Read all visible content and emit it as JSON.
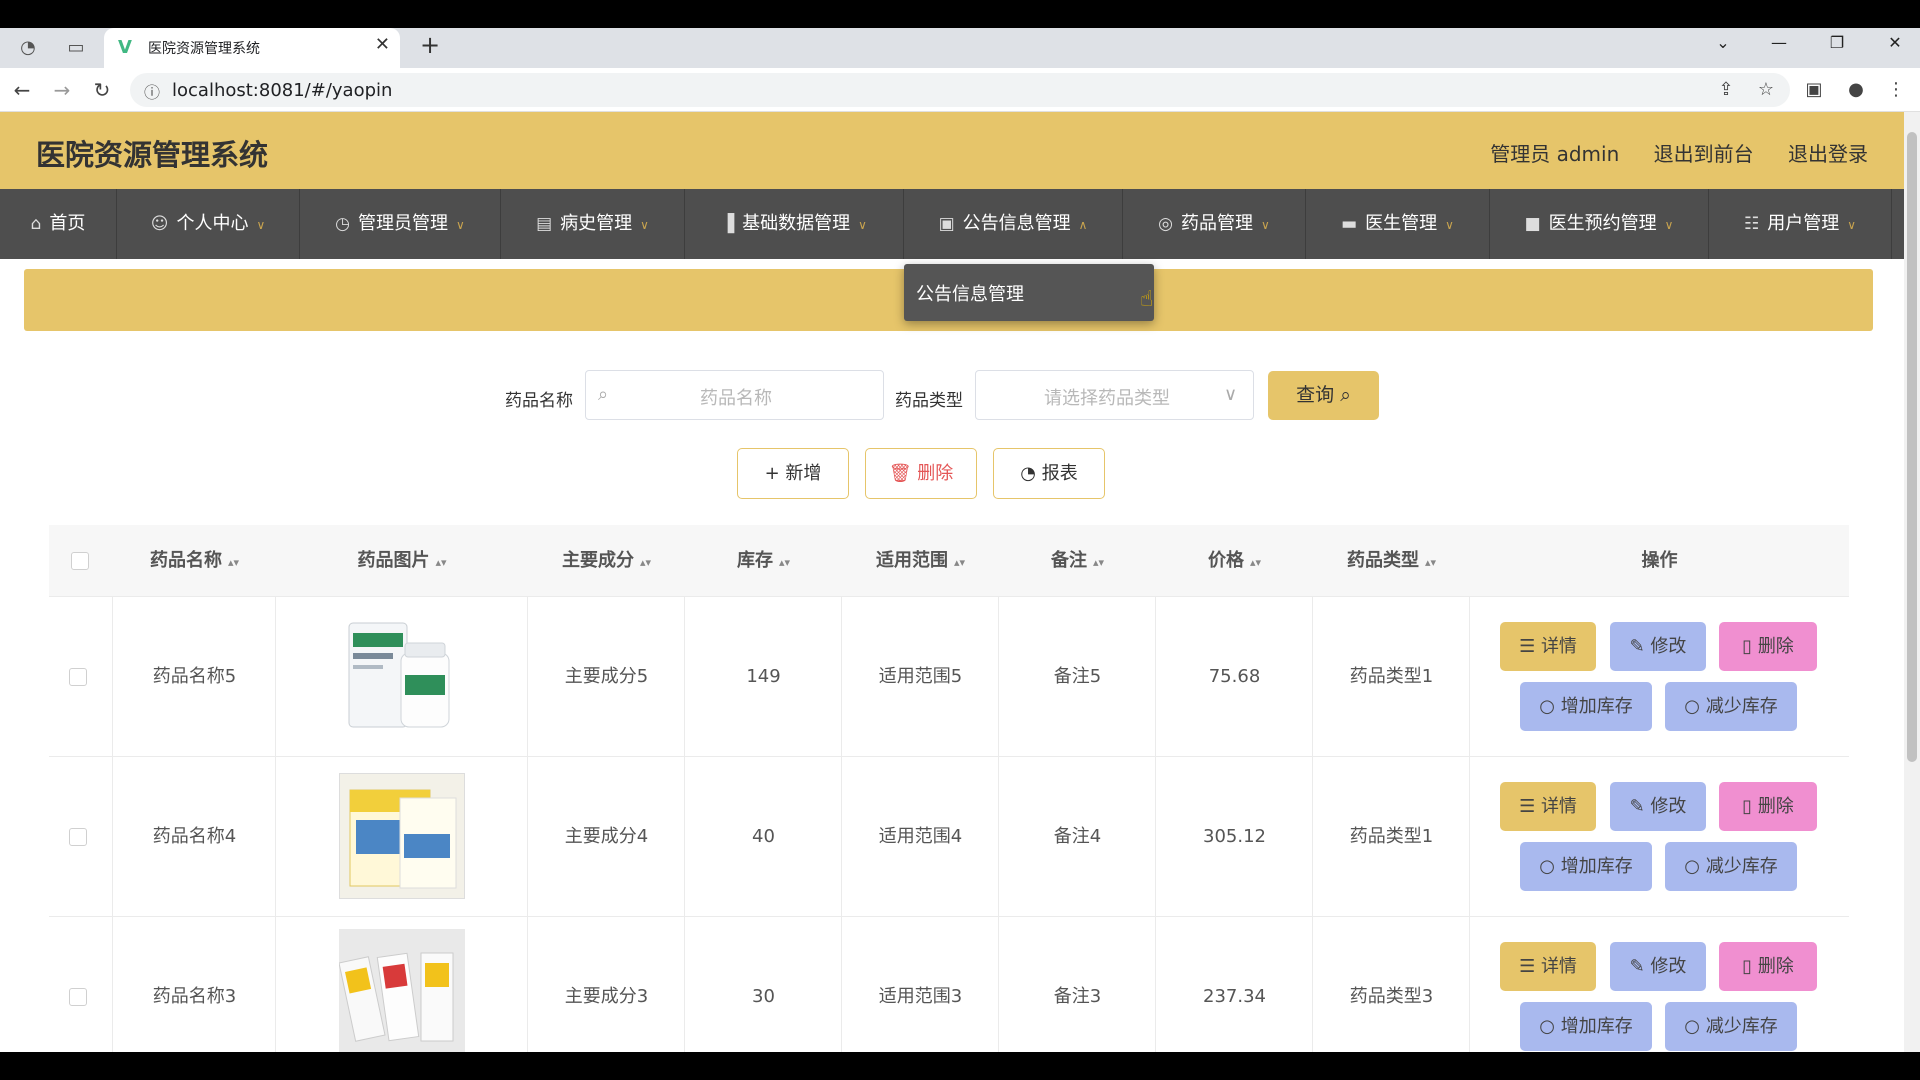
{
  "browser": {
    "tab_title": "医院资源管理系统",
    "url": "localhost:8081/#/yaopin"
  },
  "header": {
    "brand": "医院资源管理系统",
    "user": "管理员 admin",
    "to_front": "退出到前台",
    "logout": "退出登录"
  },
  "menu": [
    {
      "label": "首页",
      "icon": "home-icon"
    },
    {
      "label": "个人中心",
      "icon": "user-icon"
    },
    {
      "label": "管理员管理",
      "icon": "clock-icon"
    },
    {
      "label": "病史管理",
      "icon": "comment-icon"
    },
    {
      "label": "基础数据管理",
      "icon": "bar-chart-icon"
    },
    {
      "label": "公告信息管理",
      "icon": "clipboard-icon"
    },
    {
      "label": "药品管理",
      "icon": "circle-icon"
    },
    {
      "label": "医生管理",
      "icon": "monitor-icon"
    },
    {
      "label": "医生预约管理",
      "icon": "pin-icon"
    },
    {
      "label": "用户管理",
      "icon": "grid-icon"
    }
  ],
  "dropdown": {
    "item": "公告信息管理"
  },
  "search": {
    "name_label": "药品名称",
    "name_placeholder": "药品名称",
    "type_label": "药品类型",
    "type_placeholder": "请选择药品类型",
    "query_button": "查询"
  },
  "actions": {
    "add": "新增",
    "delete": "删除",
    "report": "报表"
  },
  "table": {
    "headers": [
      "药品名称",
      "药品图片",
      "主要成分",
      "库存",
      "适用范围",
      "备注",
      "价格",
      "药品类型",
      "操作"
    ],
    "rows": [
      {
        "name": "药品名称5",
        "ingredient": "主要成分5",
        "stock": "149",
        "scope": "适用范围5",
        "note": "备注5",
        "price": "75.68",
        "type": "药品类型1"
      },
      {
        "name": "药品名称4",
        "ingredient": "主要成分4",
        "stock": "40",
        "scope": "适用范围4",
        "note": "备注4",
        "price": "305.12",
        "type": "药品类型1"
      },
      {
        "name": "药品名称3",
        "ingredient": "主要成分3",
        "stock": "30",
        "scope": "适用范围3",
        "note": "备注3",
        "price": "237.34",
        "type": "药品类型3"
      }
    ],
    "ops": {
      "detail": "详情",
      "edit": "修改",
      "delete": "删除",
      "add_stock": "增加库存",
      "reduce_stock": "减少库存"
    }
  },
  "colors": {
    "accent": "#e6c56a",
    "menu_bg": "#4e4e4e",
    "blue_btn": "#a9b9ee",
    "pink_btn": "#f08fd0"
  }
}
